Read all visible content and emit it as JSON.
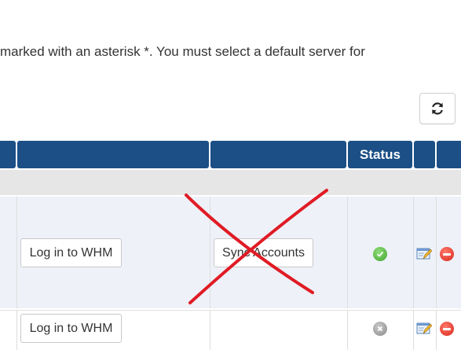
{
  "intro_text": "marked with an asterisk *. You must select a default server for",
  "table": {
    "headers": [
      "",
      "",
      "",
      "Status",
      "",
      ""
    ],
    "rows": [
      {
        "login_button": "Log in to WHM",
        "sync_button": "Sync Accounts",
        "status": "ok-icon"
      },
      {
        "login_button": "Log in to WHM",
        "status": "disabled-icon"
      }
    ]
  },
  "icons": {
    "refresh": "refresh-icon",
    "edit": "edit-icon",
    "delete": "delete-icon"
  },
  "colors": {
    "header": "#1b4f86",
    "annotation": "#e01b24",
    "status_ok": "#3fa52c",
    "delete": "#d7261a"
  }
}
